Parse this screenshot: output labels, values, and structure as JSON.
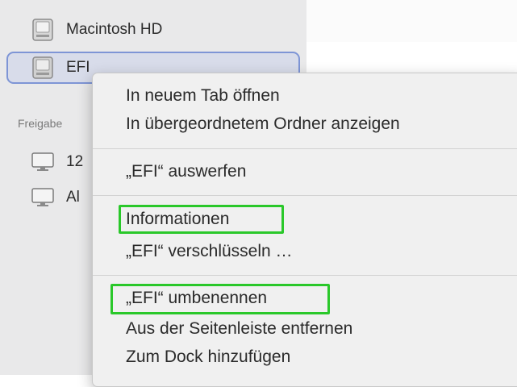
{
  "sidebar": {
    "devices": [
      {
        "label": "Macintosh HD",
        "icon": "hard-drive-icon"
      },
      {
        "label": "EFI",
        "icon": "hard-drive-icon",
        "selected": true
      }
    ],
    "shared_heading": "Freigabe",
    "shared": [
      {
        "label": "12",
        "icon": "computer-icon"
      },
      {
        "label": "Al",
        "icon": "computer-icon"
      }
    ]
  },
  "context_menu": {
    "groups": [
      [
        "In neuem Tab öffnen",
        "In übergeordnetem Ordner anzeigen"
      ],
      [
        "„EFI“ auswerfen"
      ],
      [
        "Informationen",
        "„EFI“ verschlüsseln …"
      ],
      [
        "„EFI“ umbenennen",
        "Aus der Seitenleiste entfernen",
        "Zum Dock hinzufügen"
      ]
    ],
    "highlighted_items": [
      "Informationen",
      "„EFI“ umbenennen"
    ],
    "highlight_color": "#2ac82a"
  },
  "colors": {
    "sidebar_bg": "#e9e9ea",
    "selection_border": "#7e95d6",
    "menu_bg": "#f0f0f0"
  }
}
